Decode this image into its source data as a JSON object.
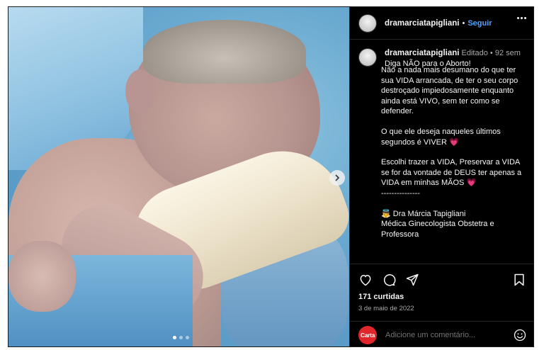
{
  "post": {
    "username": "dramarciatapigliani",
    "separator": "•",
    "follow_label": "Seguir",
    "caption": {
      "edited_label": "Editado",
      "separator": "•",
      "time_ago": "92 sem",
      "title": "Diga NÃO para o Aborto!",
      "para1": "Não a nada mais desumano do que ter sua VIDA arrancada, de ter o seu corpo destroçado impiedosamente enquanto ainda está VIVO, sem ter como se defender.",
      "para2": "O que ele deseja naqueles últimos segundos é VIVER",
      "para3": "Escolhi trazer a VIDA, Preservar a VIDA se for da vontade de DEUS ter apenas a VIDA em minhas MÃOS",
      "divider": "---------------",
      "sig_name": "Dra Márcia Tapigliani",
      "sig_role": "Médica Ginecologista Obstetra e Professora",
      "heart_emoji": "💗",
      "angel_emoji": "👼"
    },
    "likes": "171 curtidas",
    "date": "3 de maio de 2022",
    "comment_placeholder": "Adicione um comentário...",
    "commenter_avatar_text": "Carta",
    "carousel": {
      "count": 3,
      "active": 1
    }
  },
  "colors": {
    "background": "#000000",
    "text": "#f5f5f5",
    "follow": "#4ea3ff",
    "muted": "#a8a8a8",
    "heart": "#ff4fa3",
    "carta_badge": "#e0262b"
  },
  "icons": [
    "more-options-icon",
    "heart-icon",
    "comment-icon",
    "share-icon",
    "bookmark-icon",
    "emoji-icon",
    "next-arrow-icon"
  ]
}
